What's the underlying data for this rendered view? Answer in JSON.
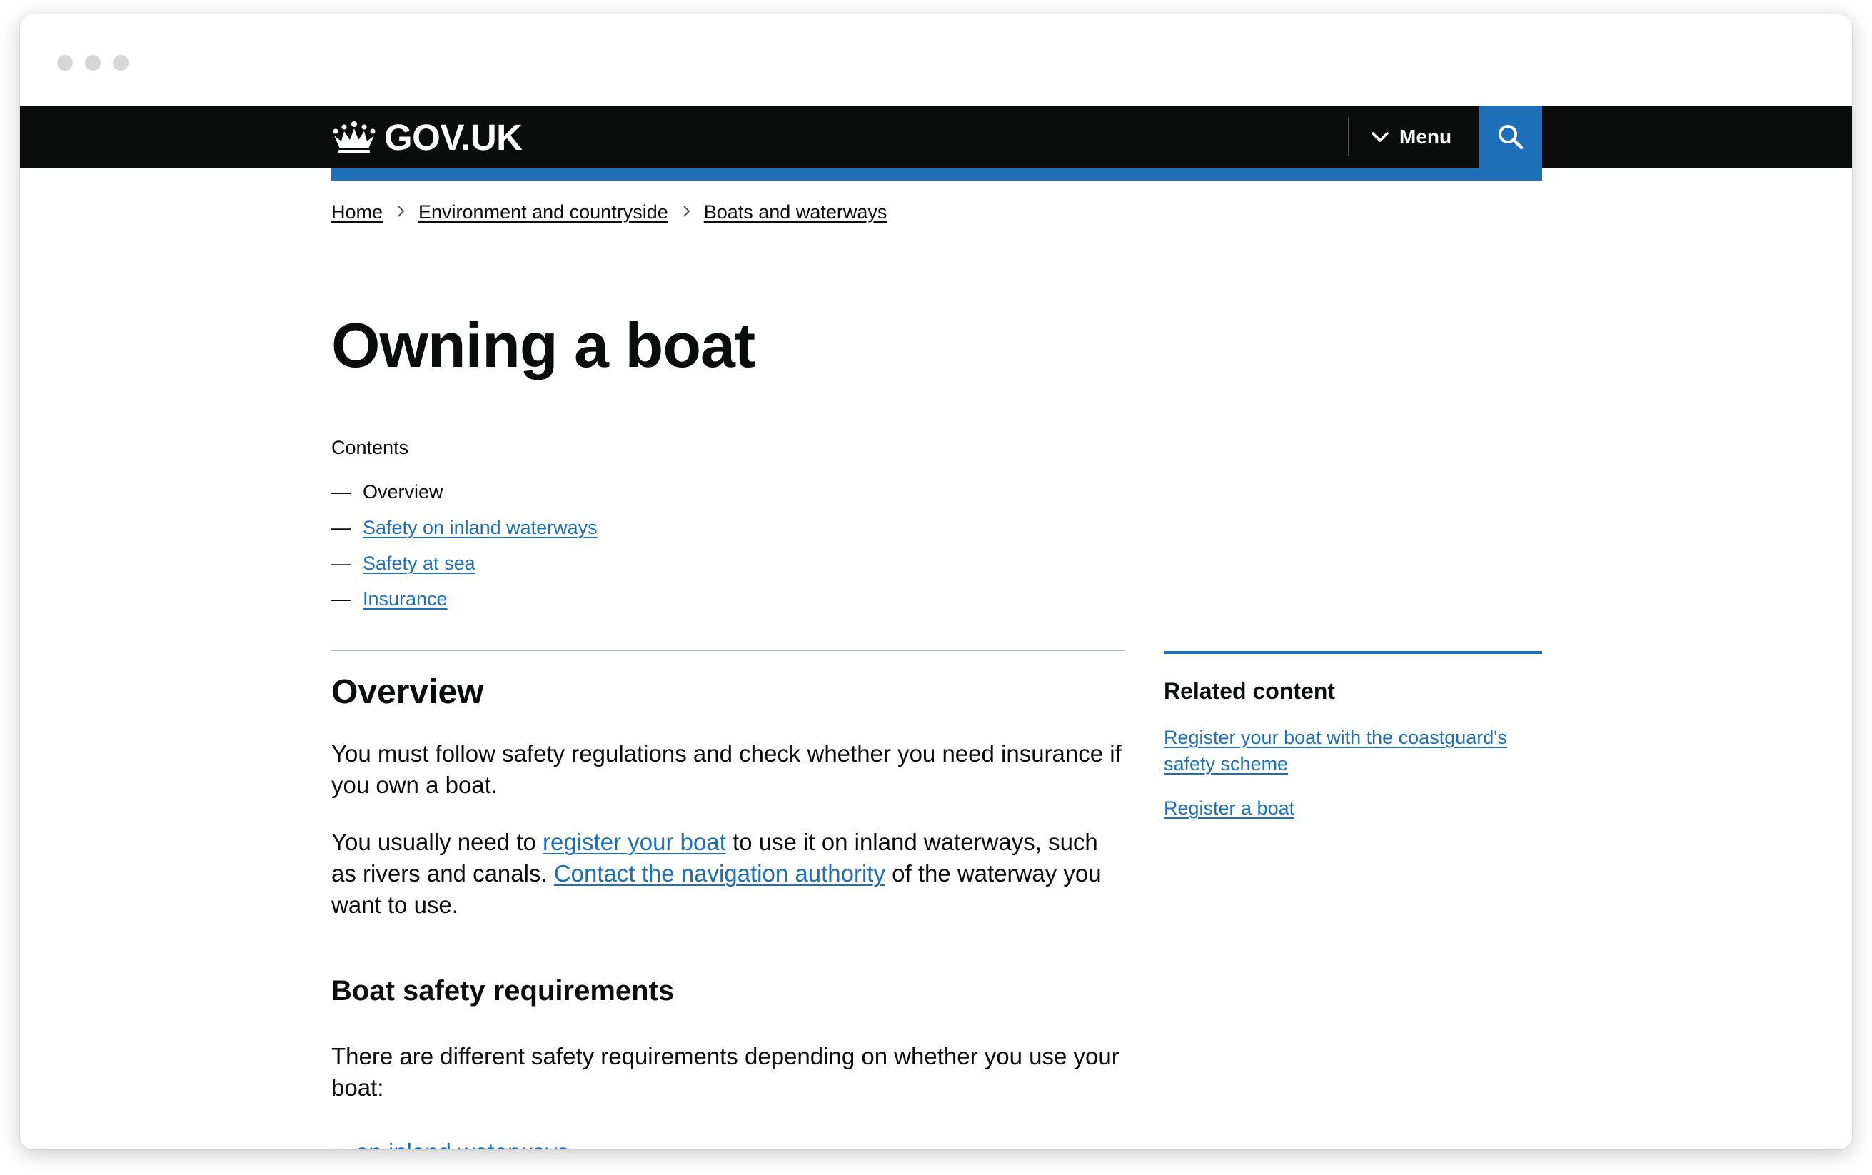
{
  "header": {
    "logo_text": "GOV.UK",
    "menu_label": "Menu"
  },
  "breadcrumbs": [
    "Home",
    "Environment and countryside",
    "Boats and waterways"
  ],
  "page": {
    "title": "Owning a boat"
  },
  "contents": {
    "label": "Contents",
    "items": [
      {
        "label": "Overview",
        "current": true
      },
      {
        "label": "Safety on inland waterways",
        "current": false
      },
      {
        "label": "Safety at sea",
        "current": false
      },
      {
        "label": "Insurance",
        "current": false
      }
    ]
  },
  "overview": {
    "heading": "Overview",
    "para1": "You must follow safety regulations and check whether you need insurance if you own a boat.",
    "para2_before": "You usually need to ",
    "para2_link1": "register your boat",
    "para2_middle": " to use it on inland waterways, such as rivers and canals. ",
    "para2_link2": "Contact the navigation authority",
    "para2_after": " of the waterway you want to use."
  },
  "safety": {
    "heading": "Boat safety requirements",
    "para": "There are different safety requirements depending on whether you use your boat:",
    "bullets": [
      "on inland waterways"
    ]
  },
  "related": {
    "title": "Related content",
    "links": [
      "Register your boat with the coastguard's safety scheme",
      "Register a boat"
    ]
  },
  "colors": {
    "header_bg": "#0b0c0c",
    "brand_blue": "#1d70b8",
    "text": "#0b0c0c"
  }
}
